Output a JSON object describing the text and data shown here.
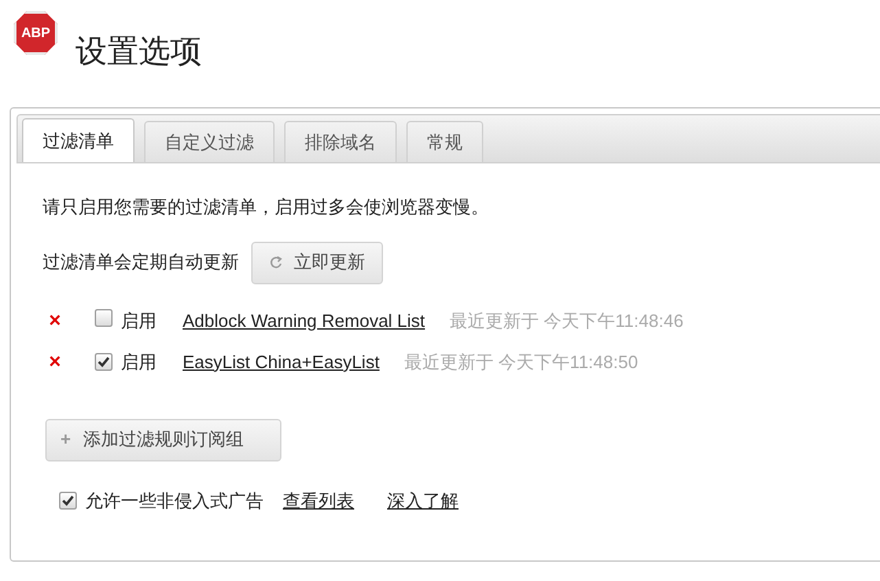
{
  "header": {
    "logo_text": "ABP",
    "title": "设置选项"
  },
  "tabs": [
    {
      "label": "过滤清单",
      "selected": true
    },
    {
      "label": "自定义过滤",
      "selected": false
    },
    {
      "label": "排除域名",
      "selected": false
    },
    {
      "label": "常规",
      "selected": false
    }
  ],
  "intro": "请只启用您需要的过滤清单，启用过多会使浏览器变慢。",
  "update": {
    "label": "过滤清单会定期自动更新",
    "button": "立即更新"
  },
  "filters": [
    {
      "remove": "×",
      "enabled": false,
      "enable_label": "启用",
      "name": "Adblock Warning Removal List",
      "status": "最近更新于 今天下午11:48:46"
    },
    {
      "remove": "×",
      "enabled": true,
      "enable_label": "启用",
      "name": "EasyList China+EasyList",
      "status": "最近更新于 今天下午11:48:50"
    }
  ],
  "add_button": {
    "icon": "+",
    "label": "添加过滤规则订阅组"
  },
  "acceptable_ads": {
    "checked": true,
    "label": "允许一些非侵入式广告",
    "links": [
      "查看列表",
      "深入了解"
    ]
  }
}
